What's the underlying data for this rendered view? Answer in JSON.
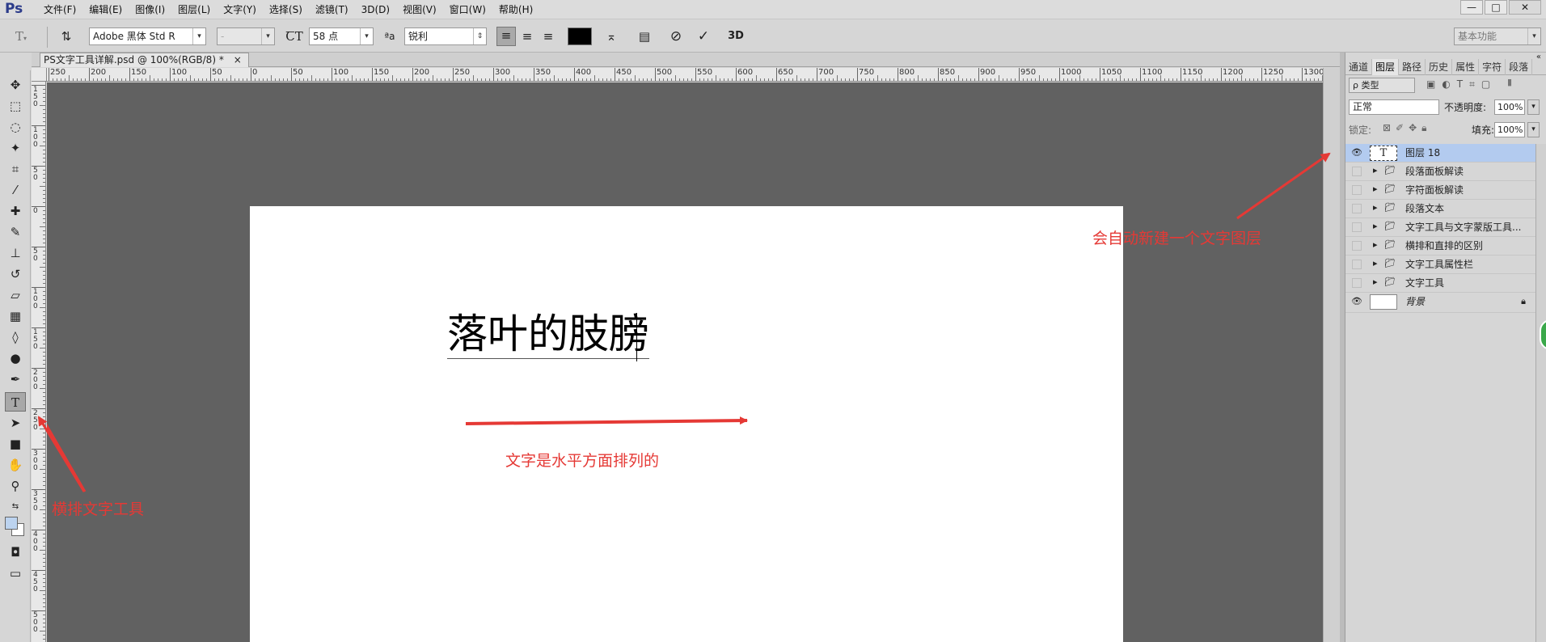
{
  "app": {
    "logo": "Ps"
  },
  "menu": [
    "文件(F)",
    "编辑(E)",
    "图像(I)",
    "图层(L)",
    "文字(Y)",
    "选择(S)",
    "滤镜(T)",
    "3D(D)",
    "视图(V)",
    "窗口(W)",
    "帮助(H)"
  ],
  "window_buttons": [
    "—",
    "□",
    "✕"
  ],
  "options": {
    "font_family": "Adobe 黑体 Std R",
    "font_style": "-",
    "font_size": "58 点",
    "aa_label": "ªa",
    "antialias": "锐利",
    "workspace": "基本功能",
    "three_d": "3D"
  },
  "document": {
    "tab_title": "PS文字工具详解.psd @ 100%(RGB/8) *",
    "tab_close": "×",
    "text": "落叶的肢膀"
  },
  "ruler": {
    "h_labels": [
      "250",
      "200",
      "150",
      "100",
      "50",
      "0",
      "50",
      "100",
      "150",
      "200",
      "250",
      "300",
      "350",
      "400",
      "450",
      "500",
      "550",
      "600",
      "650",
      "700",
      "750",
      "800",
      "850",
      "900",
      "950",
      "1000",
      "1050",
      "1100",
      "1150",
      "1200",
      "1250",
      "1300"
    ],
    "v_labels": [
      "150",
      "100",
      "50",
      "0",
      "50",
      "100",
      "150",
      "200",
      "250",
      "300",
      "350",
      "400",
      "450",
      "500"
    ]
  },
  "panel": {
    "tabs": [
      "通道",
      "图层",
      "路径",
      "历史",
      "属性",
      "字符",
      "段落"
    ],
    "active_tab": "图层",
    "filter": "ρ 类型",
    "blend_mode": "正常",
    "opacity_label": "不透明度:",
    "opacity": "100%",
    "lock_label": "锁定:",
    "fill_label": "填充:",
    "fill": "100%",
    "layers": [
      {
        "name": "图层 18",
        "type": "text",
        "visible": true,
        "selected": true
      },
      {
        "name": "段落面板解读",
        "type": "group",
        "visible": false
      },
      {
        "name": "字符面板解读",
        "type": "group",
        "visible": false
      },
      {
        "name": "段落文本",
        "type": "group",
        "visible": false
      },
      {
        "name": "文字工具与文字蒙版工具...",
        "type": "group",
        "visible": false
      },
      {
        "name": "横排和直排的区别",
        "type": "group",
        "visible": false
      },
      {
        "name": "文字工具属性栏",
        "type": "group",
        "visible": false
      },
      {
        "name": "文字工具",
        "type": "group",
        "visible": false
      },
      {
        "name": "背景",
        "type": "background",
        "visible": true,
        "locked": true
      }
    ]
  },
  "annotations": {
    "auto_layer": "会自动新建一个文字图层",
    "horizontal": "文字是水平方面排列的",
    "tool": "横排文字工具"
  },
  "colors": {
    "accent_red": "#e53935",
    "selected_layer": "#b3cbef",
    "canvas_bg": "#616161"
  }
}
